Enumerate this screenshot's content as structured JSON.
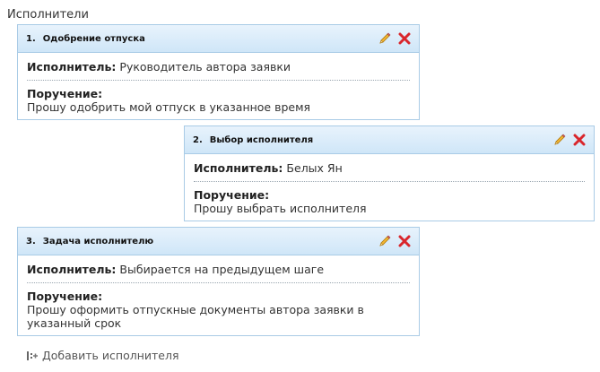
{
  "section": {
    "title": "Исполнители"
  },
  "labels": {
    "executor": "Исполнитель:",
    "order": "Поручение:"
  },
  "cards": [
    {
      "num": "1.",
      "title": "Одобрение отпуска",
      "executor": "Руководитель автора заявки",
      "order": "Прошу одобрить мой отпуск в указанное время"
    },
    {
      "num": "2.",
      "title": "Выбор исполнителя",
      "executor": "Белых Ян",
      "order": "Прошу выбрать исполнителя"
    },
    {
      "num": "3.",
      "title": "Задача исполнителю",
      "executor": "Выбирается на предыдущем шаге",
      "order": "Прошу оформить отпускные документы автора заявки в указанный срок"
    }
  ],
  "icons": {
    "edit": "pencil-icon",
    "delete": "close-icon",
    "add": "add-executor-icon"
  },
  "colors": {
    "header_border": "#a9cbe6",
    "pencil": "#e0a020",
    "delete": "#d9262c"
  },
  "footer": {
    "add_label": "Добавить исполнителя"
  }
}
